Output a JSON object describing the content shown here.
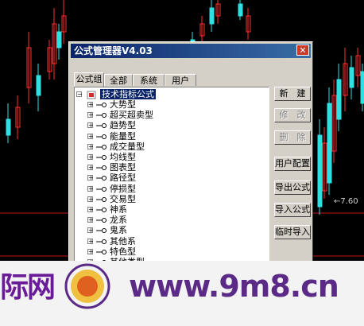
{
  "dialog": {
    "title": "公式管理器V4.03",
    "close_glyph": "✕"
  },
  "tabs": [
    "公式组",
    "全部",
    "系统",
    "用户"
  ],
  "tree": {
    "root": "技术指标公式",
    "items": [
      "大势型",
      "超买超卖型",
      "趋势型",
      "能量型",
      "成交量型",
      "均线型",
      "图表型",
      "路径型",
      "停损型",
      "交易型",
      "神系",
      "龙系",
      "鬼系",
      "其他系",
      "特色型",
      "其他类型"
    ]
  },
  "buttons": {
    "new": "新　建",
    "edit": "修　改",
    "delete": "删　除",
    "user_config": "用户配置",
    "export": "导出公式",
    "import": "导入公式",
    "temp_import": "临时导入"
  },
  "chart": {
    "price_label": "←7.60"
  },
  "watermark": {
    "left_text": "际网",
    "url": "www.9m8.cn"
  },
  "colors": {
    "up": "#ff3030",
    "down": "#30e0e0",
    "title_bar": "#0a246a",
    "watermark": "#5b2a86"
  }
}
